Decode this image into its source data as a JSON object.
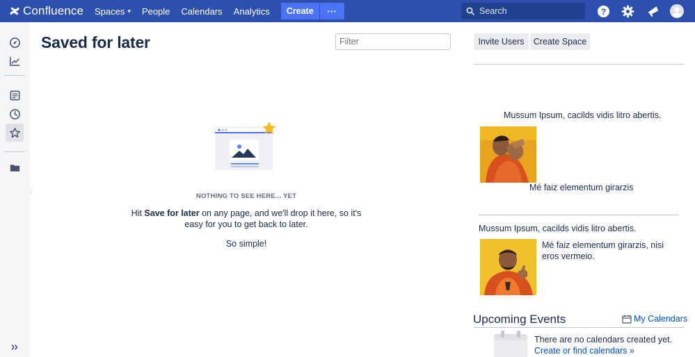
{
  "app": {
    "name": "Confluence"
  },
  "nav": {
    "spaces": "Spaces",
    "people": "People",
    "calendars": "Calendars",
    "analytics": "Analytics",
    "create": "Create",
    "more": "···",
    "search_placeholder": "Search"
  },
  "sidebar": {
    "icons": [
      "compass-icon",
      "analytics-icon",
      "pages-icon",
      "recent-icon",
      "star-icon",
      "folder-icon",
      "expand-icon"
    ],
    "active": "star-icon"
  },
  "main": {
    "title": "Saved for later",
    "filter_placeholder": "Filter",
    "empty": {
      "heading": "NOTHING TO SEE HERE... YET",
      "text_prefix": "Hit ",
      "text_bold": "Save for later",
      "text_suffix": " on any page, and we'll drop it here, so it's easy for you to get back to later.",
      "simple": "So simple!"
    }
  },
  "right": {
    "invite_users": "Invite Users",
    "create_space": "Create Space",
    "block1": {
      "top_caption": "Mussum Ipsum, cacilds vidis litro abertis.",
      "bottom_caption": "Mé faiz elementum girarzis"
    },
    "block2": {
      "top_caption": "Mussum Ipsum, cacilds vidis litro abertis.",
      "side_caption": "Mé faiz elementum girarzis, nisi eros vermeio."
    },
    "upcoming": {
      "title": "Upcoming Events",
      "my_calendars": "My Calendars",
      "no_calendars": "There are no calendars created yet.",
      "create_link": "Create or find calendars »"
    }
  },
  "colors": {
    "topbar": "#2d4fae",
    "accent": "#0052cc",
    "create_button": "#4a74f5",
    "star": "#f5b81d"
  }
}
